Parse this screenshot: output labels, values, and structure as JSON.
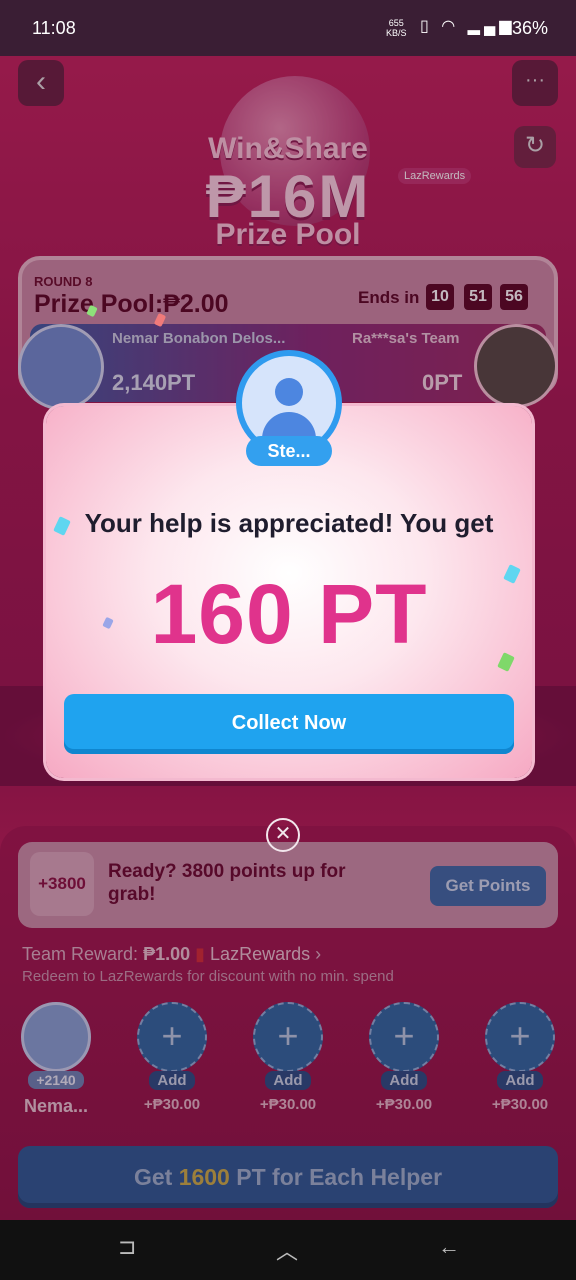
{
  "status": {
    "time": "11:08",
    "net_value": "655",
    "net_unit": "KB/S",
    "battery": "36%"
  },
  "game": {
    "title_line1": "Win&Share",
    "title_line2": "₱16M",
    "title_line3": "Prize Pool",
    "laz_tag": "LazRewards",
    "round": "ROUND 8",
    "prize_pool": "Prize Pool:₱2.00",
    "ends_label": "Ends in",
    "timer": [
      "10",
      "51",
      "56"
    ],
    "team_left_name": "Nemar Bonabon Delos...",
    "team_right_name": "Ra***sa's Team",
    "team_left_points": "2,140PT",
    "team_right_points": "0PT"
  },
  "popup": {
    "helper_name": "Ste...",
    "message": "Your help is appreciated! You get",
    "points": "160 PT",
    "collect_label": "Collect Now",
    "close_symbol": "✕"
  },
  "sheet": {
    "ready_badge": "+3800",
    "ready_text": "Ready? 3800 points up for grab!",
    "get_points_label": "Get Points",
    "team_reward_label": "Team Reward:",
    "team_reward_amount": "₱1.00",
    "team_reward_link": "LazRewards",
    "redeem_text": "Redeem to LazRewards for discount with no min. spend",
    "me_badge": "+2140",
    "me_name": "Nema...",
    "helpers": [
      {
        "add_label": "Add",
        "reward": "+₱30.00"
      },
      {
        "add_label": "Add",
        "reward": "+₱30.00"
      },
      {
        "add_label": "Add",
        "reward": "+₱30.00"
      },
      {
        "add_label": "Add",
        "reward": "+₱30.00"
      }
    ],
    "cta_prefix": "Get ",
    "cta_highlight": "1600",
    "cta_suffix": " PT for Each Helper"
  }
}
